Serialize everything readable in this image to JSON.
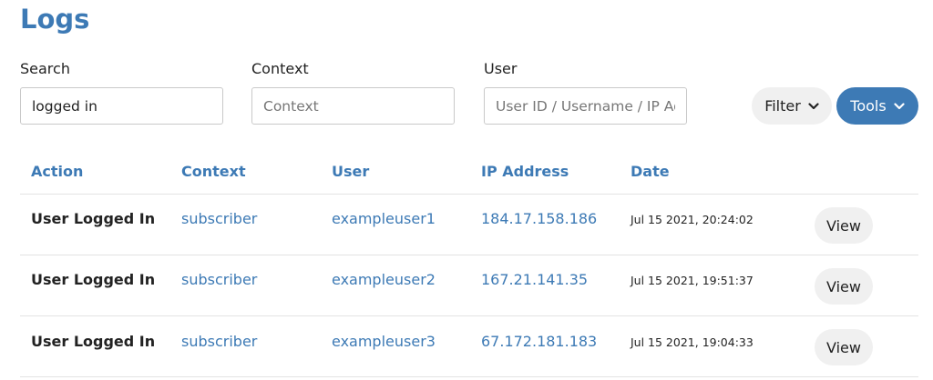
{
  "page": {
    "title": "Logs"
  },
  "search": {
    "label": "Search",
    "value": "logged in",
    "placeholder": "Search"
  },
  "context": {
    "label": "Context",
    "value": "",
    "placeholder": "Context"
  },
  "user": {
    "label": "User",
    "value": "",
    "placeholder": "User ID / Username / IP Address"
  },
  "toolbar": {
    "filter_label": "Filter",
    "tools_label": "Tools"
  },
  "colors": {
    "accent": "#3d7ab5"
  },
  "table": {
    "headers": {
      "action": "Action",
      "context": "Context",
      "user": "User",
      "ip": "IP Address",
      "date": "Date"
    },
    "rows": [
      {
        "action": "User Logged In",
        "context": "subscriber",
        "user": "exampleuser1",
        "ip": "184.17.158.186",
        "date": "Jul 15 2021, 20:24:02",
        "view_label": "View"
      },
      {
        "action": "User Logged In",
        "context": "subscriber",
        "user": "exampleuser2",
        "ip": "167.21.141.35",
        "date": "Jul 15 2021, 19:51:37",
        "view_label": "View"
      },
      {
        "action": "User Logged In",
        "context": "subscriber",
        "user": "exampleuser3",
        "ip": "67.172.181.183",
        "date": "Jul 15 2021, 19:04:33",
        "view_label": "View"
      }
    ]
  }
}
